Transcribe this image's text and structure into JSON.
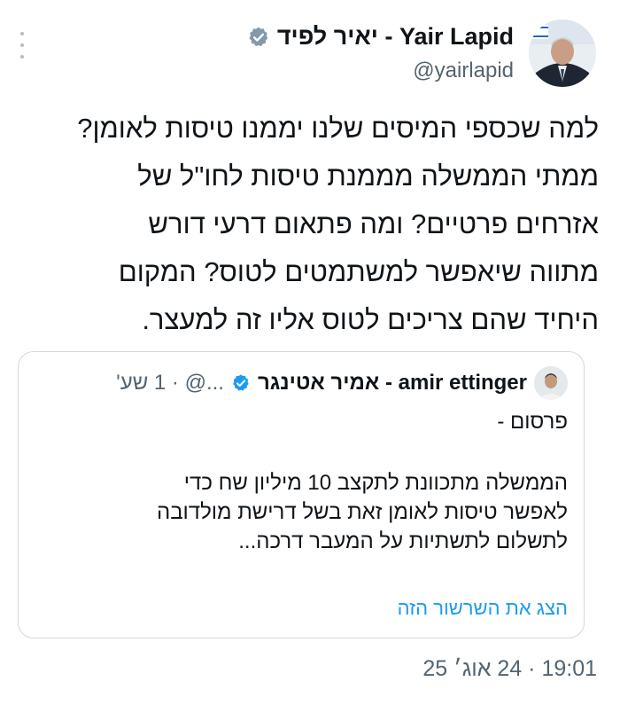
{
  "author": {
    "name": "Yair Lapid - יאיר לפיד",
    "handle": "@yairlapid"
  },
  "tweet": {
    "lines": [
      "למה שכספי המיסים שלנו יממנו טיסות לאומן?",
      "ממתי הממשלה מממנת טיסות לחו\"ל של",
      "אזרחים פרטיים? ומה פתאום דרעי דורש",
      "מתווה שיאפשר למשתמטים לטוס? המקום",
      "היחיד שהם צריכים לטוס אליו זה למעצר."
    ]
  },
  "quoted": {
    "name": "amir ettinger - אמיר אטינגר",
    "meta": "...@ · 1 שע'",
    "line1": "פרסום -",
    "body_lines": [
      "הממשלה מתכוונת לתקצב 10 מיליון שח כדי",
      "לאפשר טיסות לאומן זאת בשל דרישת מולדובה",
      "לתשלום לתשתיות על המעבר דרכה..."
    ],
    "show_thread": "הצג את השרשור הזה"
  },
  "timestamp": "19:01 · 24 אוג׳ 25",
  "colors": {
    "accent": "#1d9bf0",
    "verified_gray": "#829aab",
    "verified_blue": "#1d9bf0",
    "secondary_text": "#536471"
  },
  "icons": [
    "verified-gray-icon",
    "verified-blue-icon",
    "more-icon"
  ]
}
